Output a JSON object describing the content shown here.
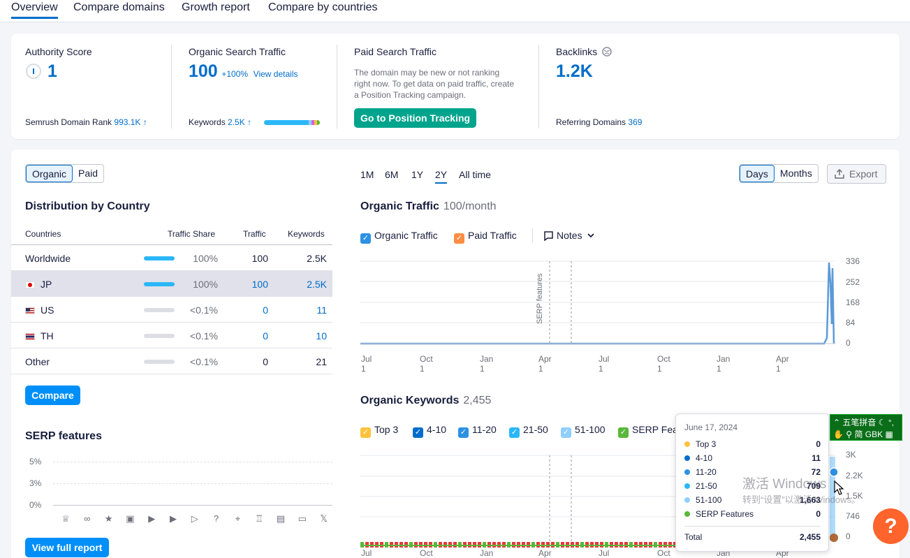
{
  "nav": {
    "tabs": [
      "Overview",
      "Compare domains",
      "Growth report",
      "Compare by countries"
    ]
  },
  "summary": {
    "authority": {
      "label": "Authority Score",
      "value": "1",
      "rank_label": "Semrush Domain Rank",
      "rank_value": "993.1K",
      "trend": "↑"
    },
    "organic": {
      "label": "Organic Search Traffic",
      "value": "100",
      "change": "+100%",
      "link": "View details",
      "kw_label": "Keywords",
      "kw_value": "2.5K",
      "trend": "↑"
    },
    "paid": {
      "label": "Paid Search Traffic",
      "desc": "The domain may be new or not ranking right now. To get data on paid traffic, create a Position Tracking campaign.",
      "button": "Go to Position Tracking"
    },
    "backlinks": {
      "label": "Backlinks",
      "value": "1.2K",
      "ref_label": "Referring Domains",
      "ref_value": "369"
    }
  },
  "left": {
    "toggle": [
      "Organic",
      "Paid"
    ],
    "dist_title": "Distribution by Country",
    "columns": [
      "Countries",
      "Traffic Share",
      "Traffic",
      "Keywords"
    ],
    "rows": [
      {
        "country": "Worldwide",
        "share": "100%",
        "traffic": "100",
        "keywords": "2.5K",
        "bar": 1
      },
      {
        "country": "JP",
        "share": "100%",
        "traffic": "100",
        "keywords": "2.5K",
        "bar": 1
      },
      {
        "country": "US",
        "share": "<0.1%",
        "traffic": "0",
        "keywords": "11",
        "bar": 0
      },
      {
        "country": "TH",
        "share": "<0.1%",
        "traffic": "0",
        "keywords": "10",
        "bar": 0
      },
      {
        "country": "Other",
        "share": "<0.1%",
        "traffic": "0",
        "keywords": "21",
        "bar": 0
      }
    ],
    "compare_btn": "Compare",
    "serp_title": "SERP features",
    "serp_axis": [
      "5%",
      "3%",
      "0%"
    ],
    "full_report_btn": "View full report"
  },
  "right": {
    "ranges": [
      "1M",
      "6M",
      "1Y",
      "2Y",
      "All time"
    ],
    "granularity": [
      "Days",
      "Months"
    ],
    "export": "Export",
    "traffic_title": "Organic Traffic",
    "traffic_sub": "100/month",
    "traffic_legend": {
      "organic": "Organic Traffic",
      "paid": "Paid Traffic",
      "notes": "Notes"
    },
    "traffic_axis": [
      "336",
      "252",
      "168",
      "84",
      "0"
    ],
    "serp_marker": "SERP features",
    "x_axis": [
      "Jul 1",
      "Oct 1",
      "Jan 1",
      "Apr 1",
      "Jul 1",
      "Oct 1",
      "Jan 1",
      "Apr 1"
    ],
    "kw_title": "Organic Keywords",
    "kw_sub": "2,455",
    "kw_legend": [
      "Top 3",
      "4-10",
      "11-20",
      "21-50",
      "51-100",
      "SERP Fea"
    ],
    "kw_axis": [
      "3K",
      "2.2K",
      "1.5K",
      "746",
      "0"
    ]
  },
  "tooltip": {
    "date": "June 17, 2024",
    "rows": [
      {
        "label": "Top 3",
        "value": "0",
        "color": "#fdc23c"
      },
      {
        "label": "4-10",
        "value": "11",
        "color": "#006dca"
      },
      {
        "label": "11-20",
        "value": "72",
        "color": "#2d91e3"
      },
      {
        "label": "21-50",
        "value": "709",
        "color": "#2bb7f7"
      },
      {
        "label": "51-100",
        "value": "1,663",
        "color": "#8fcfff"
      },
      {
        "label": "SERP Features",
        "value": "0",
        "color": "#59b73a"
      }
    ],
    "total_label": "Total",
    "total_value": "2,455"
  },
  "ime": {
    "line1": "五笔拼音",
    "line2": "简 GBK"
  },
  "watermark": {
    "line1": "激活 Windows",
    "line2": "转到“设置”以激活 Windows。"
  },
  "help": "?",
  "colors": {
    "accent": "#006dca",
    "green": "#00a48c",
    "orange": "#ff642d"
  }
}
